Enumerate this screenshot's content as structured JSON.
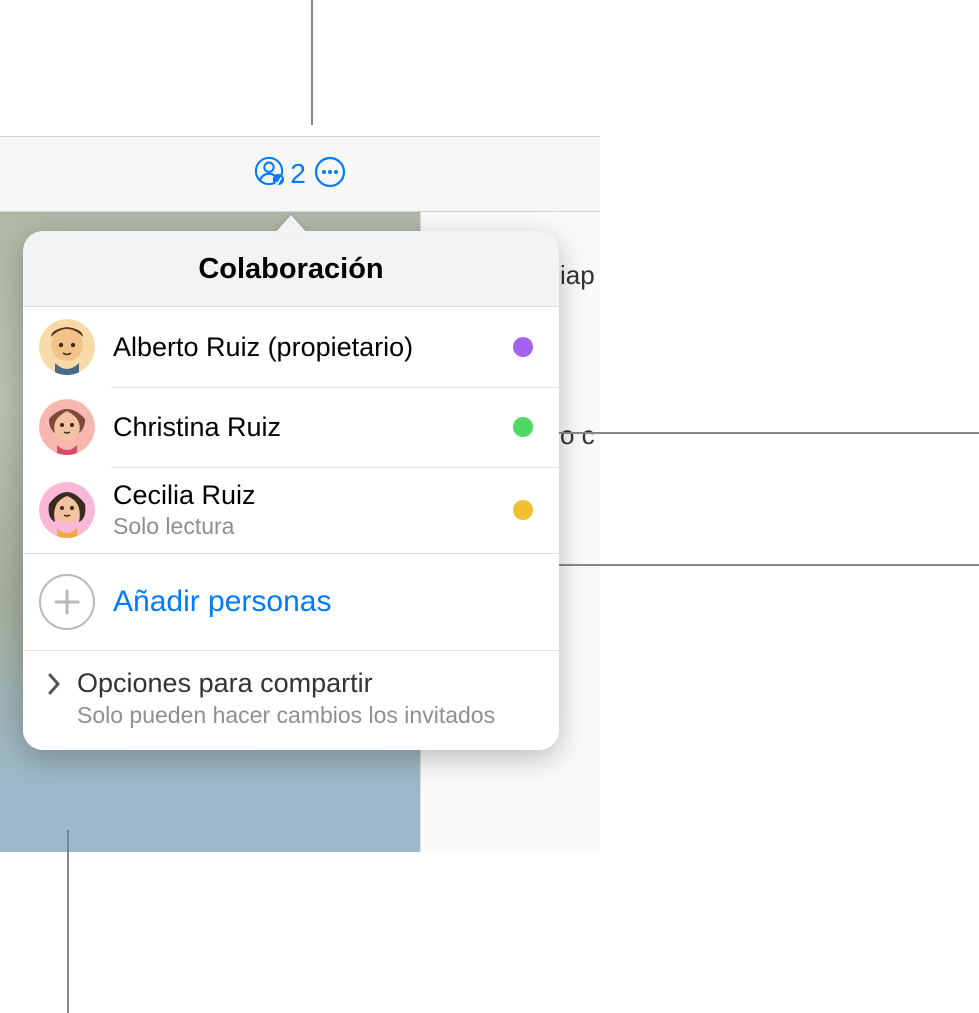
{
  "toolbar": {
    "collaborator_count": "2"
  },
  "background": {
    "sidebar_hint_1": "iap",
    "sidebar_hint_2": "o c"
  },
  "popover": {
    "title": "Colaboración",
    "participants": [
      {
        "name": "Alberto Ruiz (propietario)",
        "sub": "",
        "dot_color": "#a460f0",
        "avatar_bg": "#f8d9a8",
        "avatar_face": "#f3c28a",
        "avatar_hair": "#5a3a1f"
      },
      {
        "name": "Christina Ruiz",
        "sub": "",
        "dot_color": "#4cd964",
        "avatar_bg": "#f7b7b0",
        "avatar_face": "#f3c2a0",
        "avatar_hair": "#7a4a3a"
      },
      {
        "name": "Cecilia Ruiz",
        "sub": "Solo lectura",
        "dot_color": "#f0c030",
        "avatar_bg": "#f9b8d8",
        "avatar_face": "#f3c2a0",
        "avatar_hair": "#3a2a1f"
      }
    ],
    "add_label": "Añadir personas",
    "share_options": {
      "title": "Opciones para compartir",
      "subtitle": "Solo pueden hacer cambios los invitados"
    }
  }
}
